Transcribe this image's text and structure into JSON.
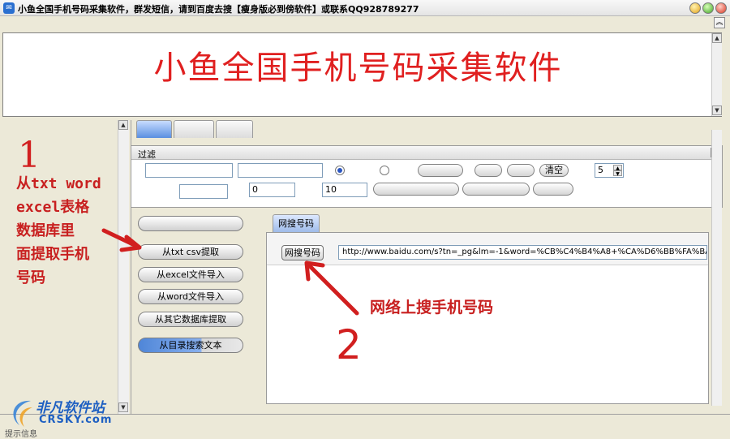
{
  "window": {
    "title": "小鱼全国手机号码采集软件，群发短信，请到百度去搜【瘦身版必到傍软件】或联系QQ928789277"
  },
  "banner": {
    "title": "小鱼全国手机号码采集软件"
  },
  "filter": {
    "label": "过滤",
    "clear_label": "清空",
    "spinner_value": "5",
    "field_min": "0",
    "field_max": "10"
  },
  "left_actions": [
    {
      "label": ""
    },
    {
      "label": "从txt csv提取"
    },
    {
      "label": "从excel文件导入"
    },
    {
      "label": "从word文件导入"
    },
    {
      "label": "从其它数据库提取"
    },
    {
      "label": "从目录搜索文本"
    }
  ],
  "web_search": {
    "tab_label": "网搜号码",
    "button_label": "网搜号码",
    "url": "http://www.baidu.com/s?tn=_pg&lm=-1&word=%CB%C4%B4%A8+%CA%D6%BB%FA%BA%C5"
  },
  "annotations": {
    "step1_number": "1",
    "step1_text": "从txt word\nexcel表格\n数据库里\n面提取手机\n号码",
    "step2_number": "2",
    "step2_text": "网络上搜手机号码"
  },
  "status": {
    "text": "提示信息"
  },
  "watermark": {
    "cn": "非凡软件站",
    "en": "CRSKY.com"
  },
  "colors": {
    "annotation_red": "#d11f1f",
    "banner_red": "#e02020",
    "accent_blue": "#2a6fd0"
  }
}
